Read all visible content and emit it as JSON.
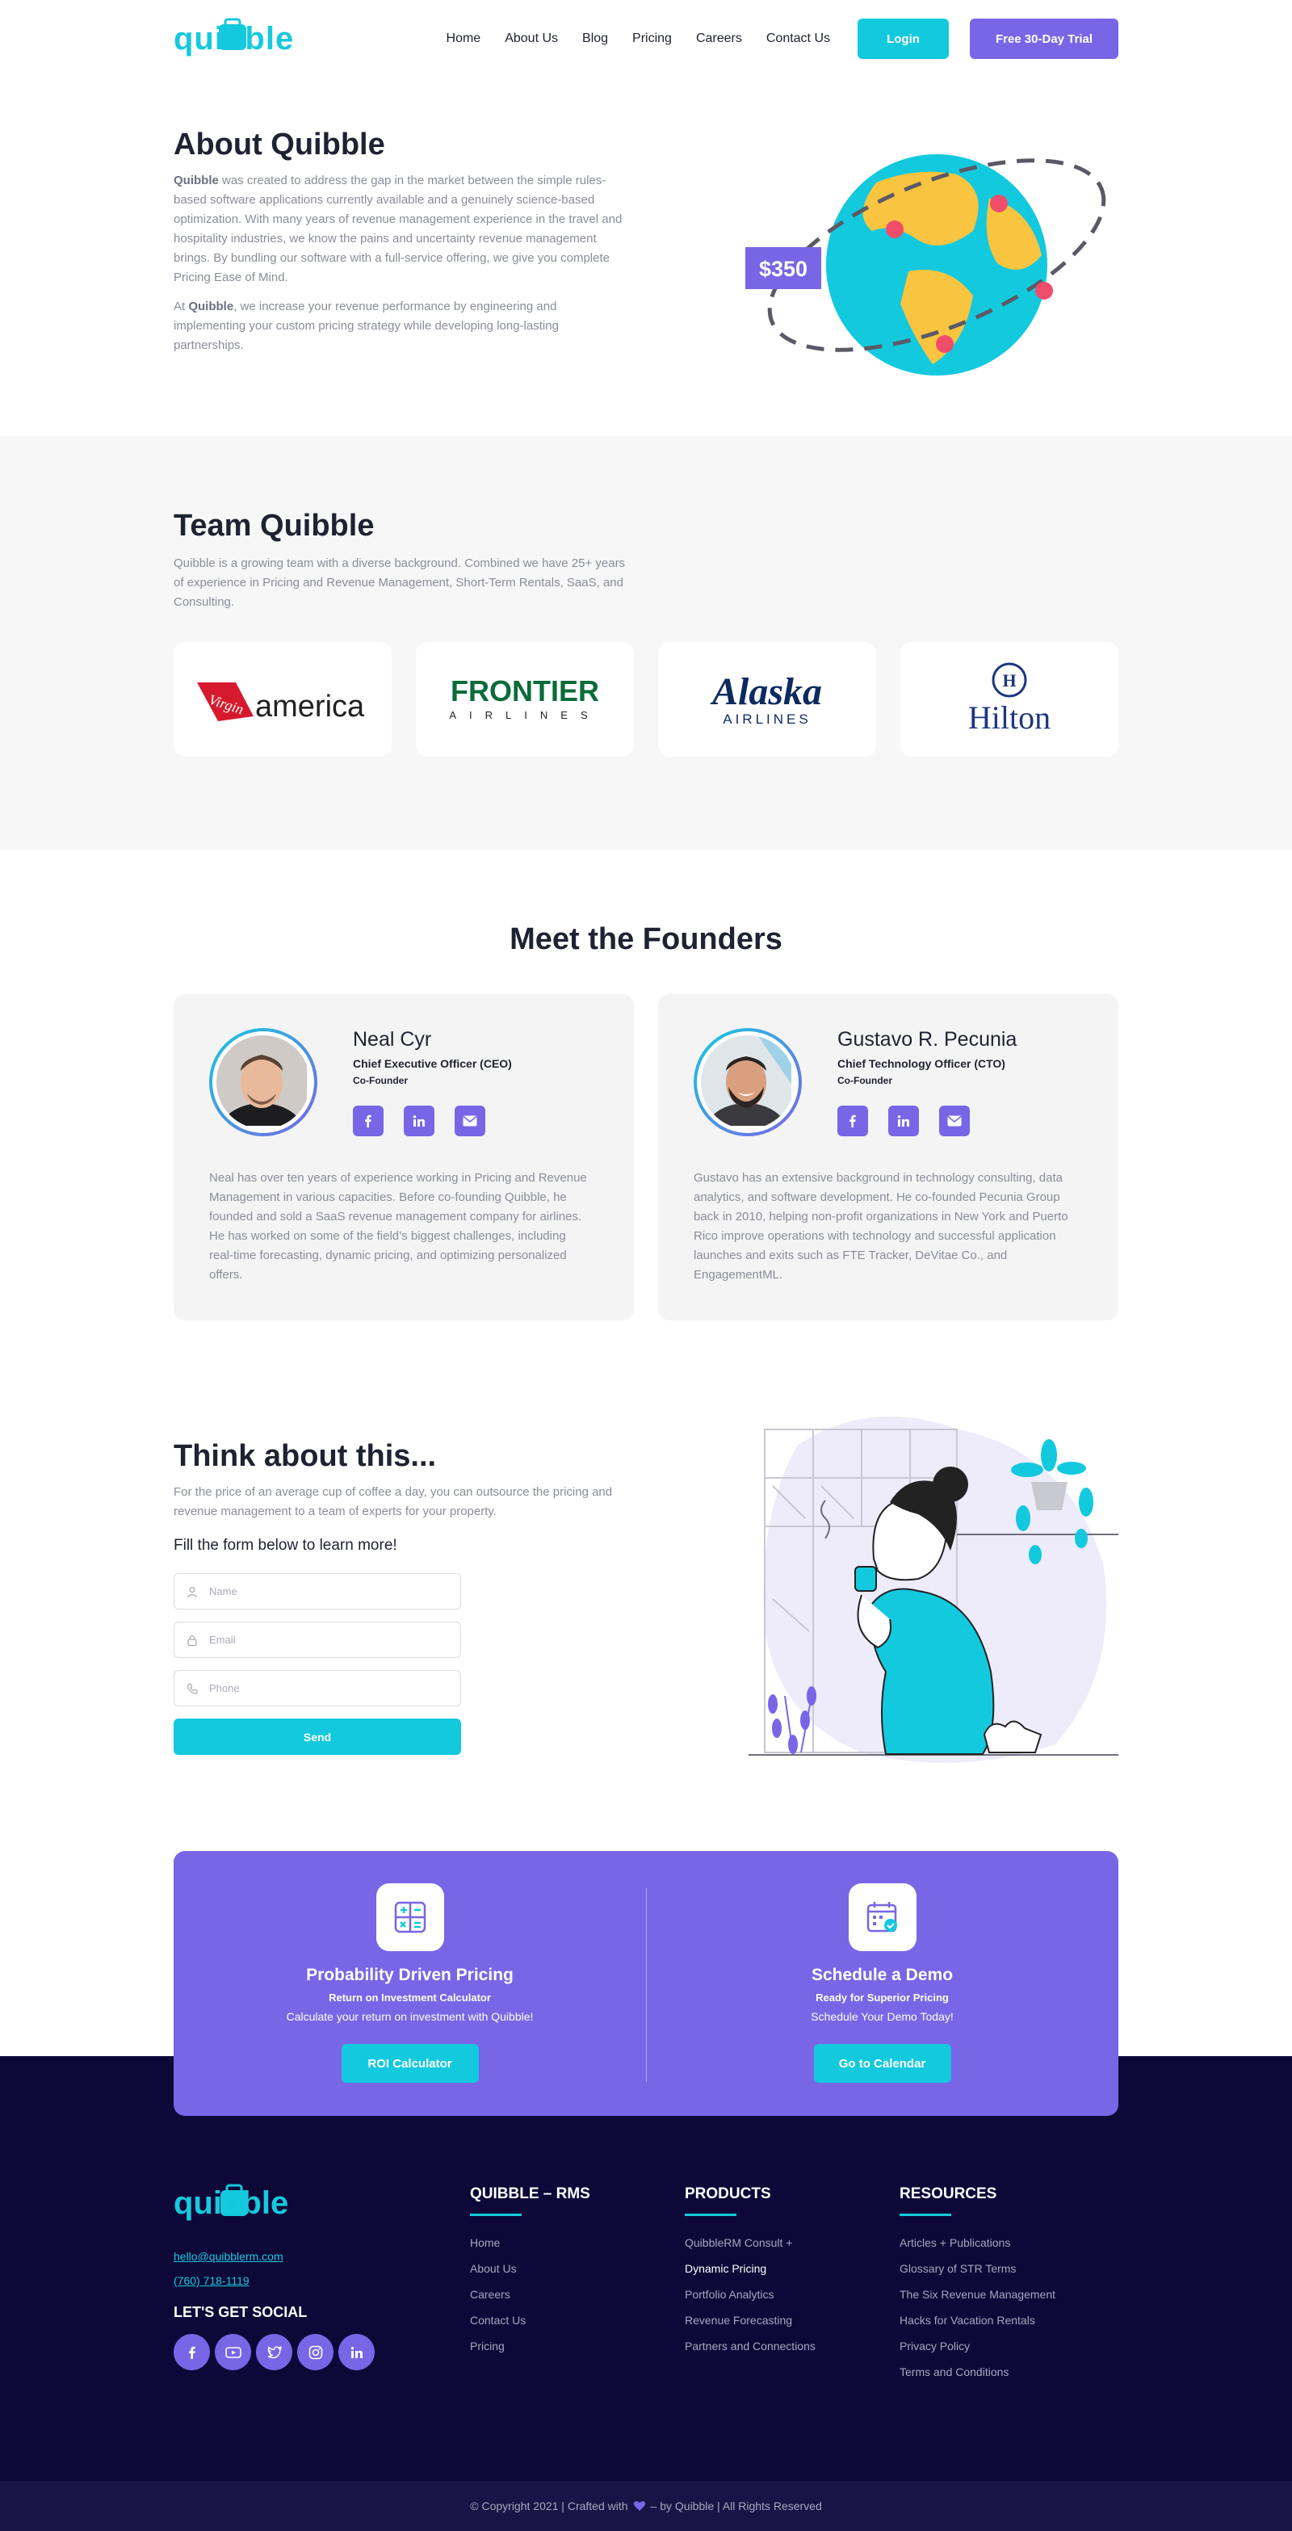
{
  "header": {
    "logo": "quibble",
    "nav": [
      "Home",
      "About Us",
      "Blog",
      "Pricing",
      "Careers",
      "Contact Us"
    ],
    "login": "Login",
    "trial": "Free 30-Day Trial"
  },
  "about": {
    "title": "About Quibble",
    "p1_brand": "Quibble",
    "p1": " was created to address the gap in the market between the simple rules-based software applications currently available and a genuinely science-based optimization. With many years of revenue management experience in the travel and hospitality industries, we know the pains and uncertainty revenue management brings. By bundling our software with a full-service offering, we give you complete Pricing Ease of Mind.",
    "p2_pre": "At ",
    "p2_brand": "Quibble",
    "p2": ", we increase your revenue performance by engineering and implementing your custom pricing strategy while developing long-lasting partnerships.",
    "price_tag": "$350"
  },
  "team": {
    "title": "Team Quibble",
    "desc": "Quibble is a growing team with a diverse background.  Combined we have 25+ years of experience in Pricing and Revenue Management, Short-Term Rentals, SaaS, and Consulting.",
    "logos": {
      "virgin_script": "Virgin",
      "virgin_word": "america",
      "frontier_main": "FRONTIER",
      "frontier_sub": "AIRLINES",
      "alaska_main": "Alaska",
      "alaska_sub": "AIRLINES",
      "hilton": "Hilton"
    }
  },
  "founders": {
    "title": "Meet the Founders",
    "people": [
      {
        "name": "Neal Cyr",
        "role": "Chief Executive Officer (CEO)",
        "sub": "Co-Founder",
        "bio": "Neal has over ten years of experience working in Pricing and Revenue Management in various capacities. Before co-founding Quibble, he founded and sold a SaaS revenue management company for airlines. He has worked on some of the field’s biggest challenges, including real-time forecasting, dynamic pricing, and optimizing personalized offers."
      },
      {
        "name": "Gustavo R. Pecunia",
        "role": "Chief Technology Officer (CTO)",
        "sub": "Co-Founder",
        "bio": "Gustavo has an extensive background in technology consulting, data analytics, and software development. He co-founded Pecunia Group back in 2010, helping non-profit organizations in New York and Puerto Rico improve operations with technology and successful application launches and exits such as FTE Tracker, DeVitae Co., and EngagementML."
      }
    ]
  },
  "think": {
    "title": "Think about this...",
    "sub": "For the price of an average cup of coffee a day, you can outsource the pricing and revenue management to a team of experts for your property.",
    "form_title": "Fill the form below to learn more!",
    "name_ph": "Name",
    "email_ph": "Email",
    "phone_ph": "Phone",
    "send": "Send"
  },
  "cta": [
    {
      "title": "Probability Driven Pricing",
      "sub": "Return on Investment Calculator",
      "text": "Calculate your return on investment with Quibble!",
      "button": "ROI Calculator"
    },
    {
      "title": "Schedule a Demo",
      "sub": "Ready for  Superior Pricing",
      "text": "Schedule Your Demo Today!",
      "button": "Go to Calendar"
    }
  ],
  "footer": {
    "logo": "quibble",
    "email": "hello@quibblerm.com",
    "phone": "(760) 718-1119",
    "social_title": "LET'S GET SOCIAL",
    "cols": [
      {
        "title": "QUIBBLE – RMS",
        "links": [
          "Home",
          "About Us",
          "Careers",
          "Contact Us",
          "Pricing"
        ]
      },
      {
        "title": "PRODUCTS",
        "links": [
          "QuibbleRM Consult +",
          "Dynamic Pricing",
          "Portfolio Analytics",
          "Revenue Forecasting",
          "Partners and Connections"
        ]
      },
      {
        "title": "RESOURCES",
        "links": [
          "Articles + Publications",
          "Glossary of STR Terms",
          "The Six Revenue Management",
          "Hacks for Vacation Rentals",
          "Privacy Policy",
          "Terms and Conditions"
        ]
      }
    ],
    "copy_pre": "© Copyright 2021 | Crafted with",
    "copy_post": "– by Quibble | All Rights Reserved"
  },
  "colors": {
    "cyan": "#13c9de",
    "purple": "#7866e6",
    "navy": "#0e0838",
    "text": "#1f2230",
    "muted": "#8a8d99"
  }
}
